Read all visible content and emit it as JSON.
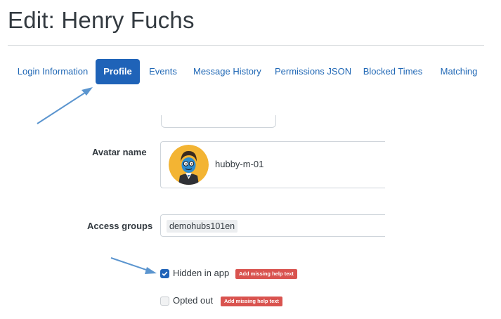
{
  "page": {
    "title": "Edit: Henry Fuchs"
  },
  "tabs": [
    {
      "label": "Login Information",
      "active": false
    },
    {
      "label": "Profile",
      "active": true
    },
    {
      "label": "Events",
      "active": false
    },
    {
      "label": "Message History",
      "active": false
    },
    {
      "label": "Permissions JSON",
      "active": false
    },
    {
      "label": "Blocked Times",
      "active": false
    },
    {
      "label": "Matching",
      "active": false
    }
  ],
  "form": {
    "avatar": {
      "label": "Avatar name",
      "value": "hubby-m-01"
    },
    "access_groups": {
      "label": "Access groups",
      "chips": [
        "demohubs101en"
      ]
    },
    "hidden_in_app": {
      "label": "Hidden in app",
      "checked": true,
      "badge": "Add missing help text"
    },
    "opted_out": {
      "label": "Opted out",
      "checked": false,
      "badge": "Add missing help text"
    }
  },
  "colors": {
    "accent": "#1f63b8",
    "badge": "#d9534f",
    "annotation": "#5b95cf"
  }
}
